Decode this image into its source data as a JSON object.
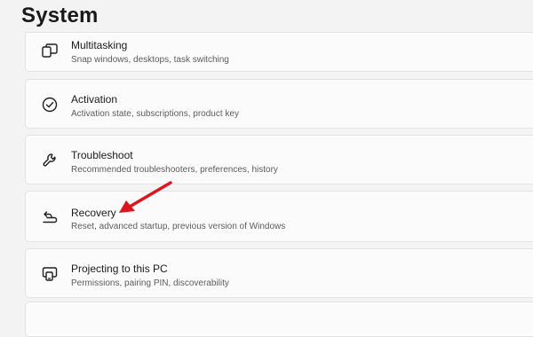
{
  "page": {
    "title": "System"
  },
  "settings": [
    {
      "title": "Multitasking",
      "subtitle": "Snap windows, desktops, task switching",
      "icon": "multitasking-icon"
    },
    {
      "title": "Activation",
      "subtitle": "Activation state, subscriptions, product key",
      "icon": "activation-check-icon"
    },
    {
      "title": "Troubleshoot",
      "subtitle": "Recommended troubleshooters, preferences, history",
      "icon": "wrench-icon"
    },
    {
      "title": "Recovery",
      "subtitle": "Reset, advanced startup, previous version of Windows",
      "icon": "recovery-icon"
    },
    {
      "title": "Projecting to this PC",
      "subtitle": "Permissions, pairing PIN, discoverability",
      "icon": "projecting-icon"
    }
  ],
  "colors": {
    "page_background": "#f3f3f3",
    "card_background": "#fbfbfb",
    "annotation_arrow": "#e0141c"
  }
}
